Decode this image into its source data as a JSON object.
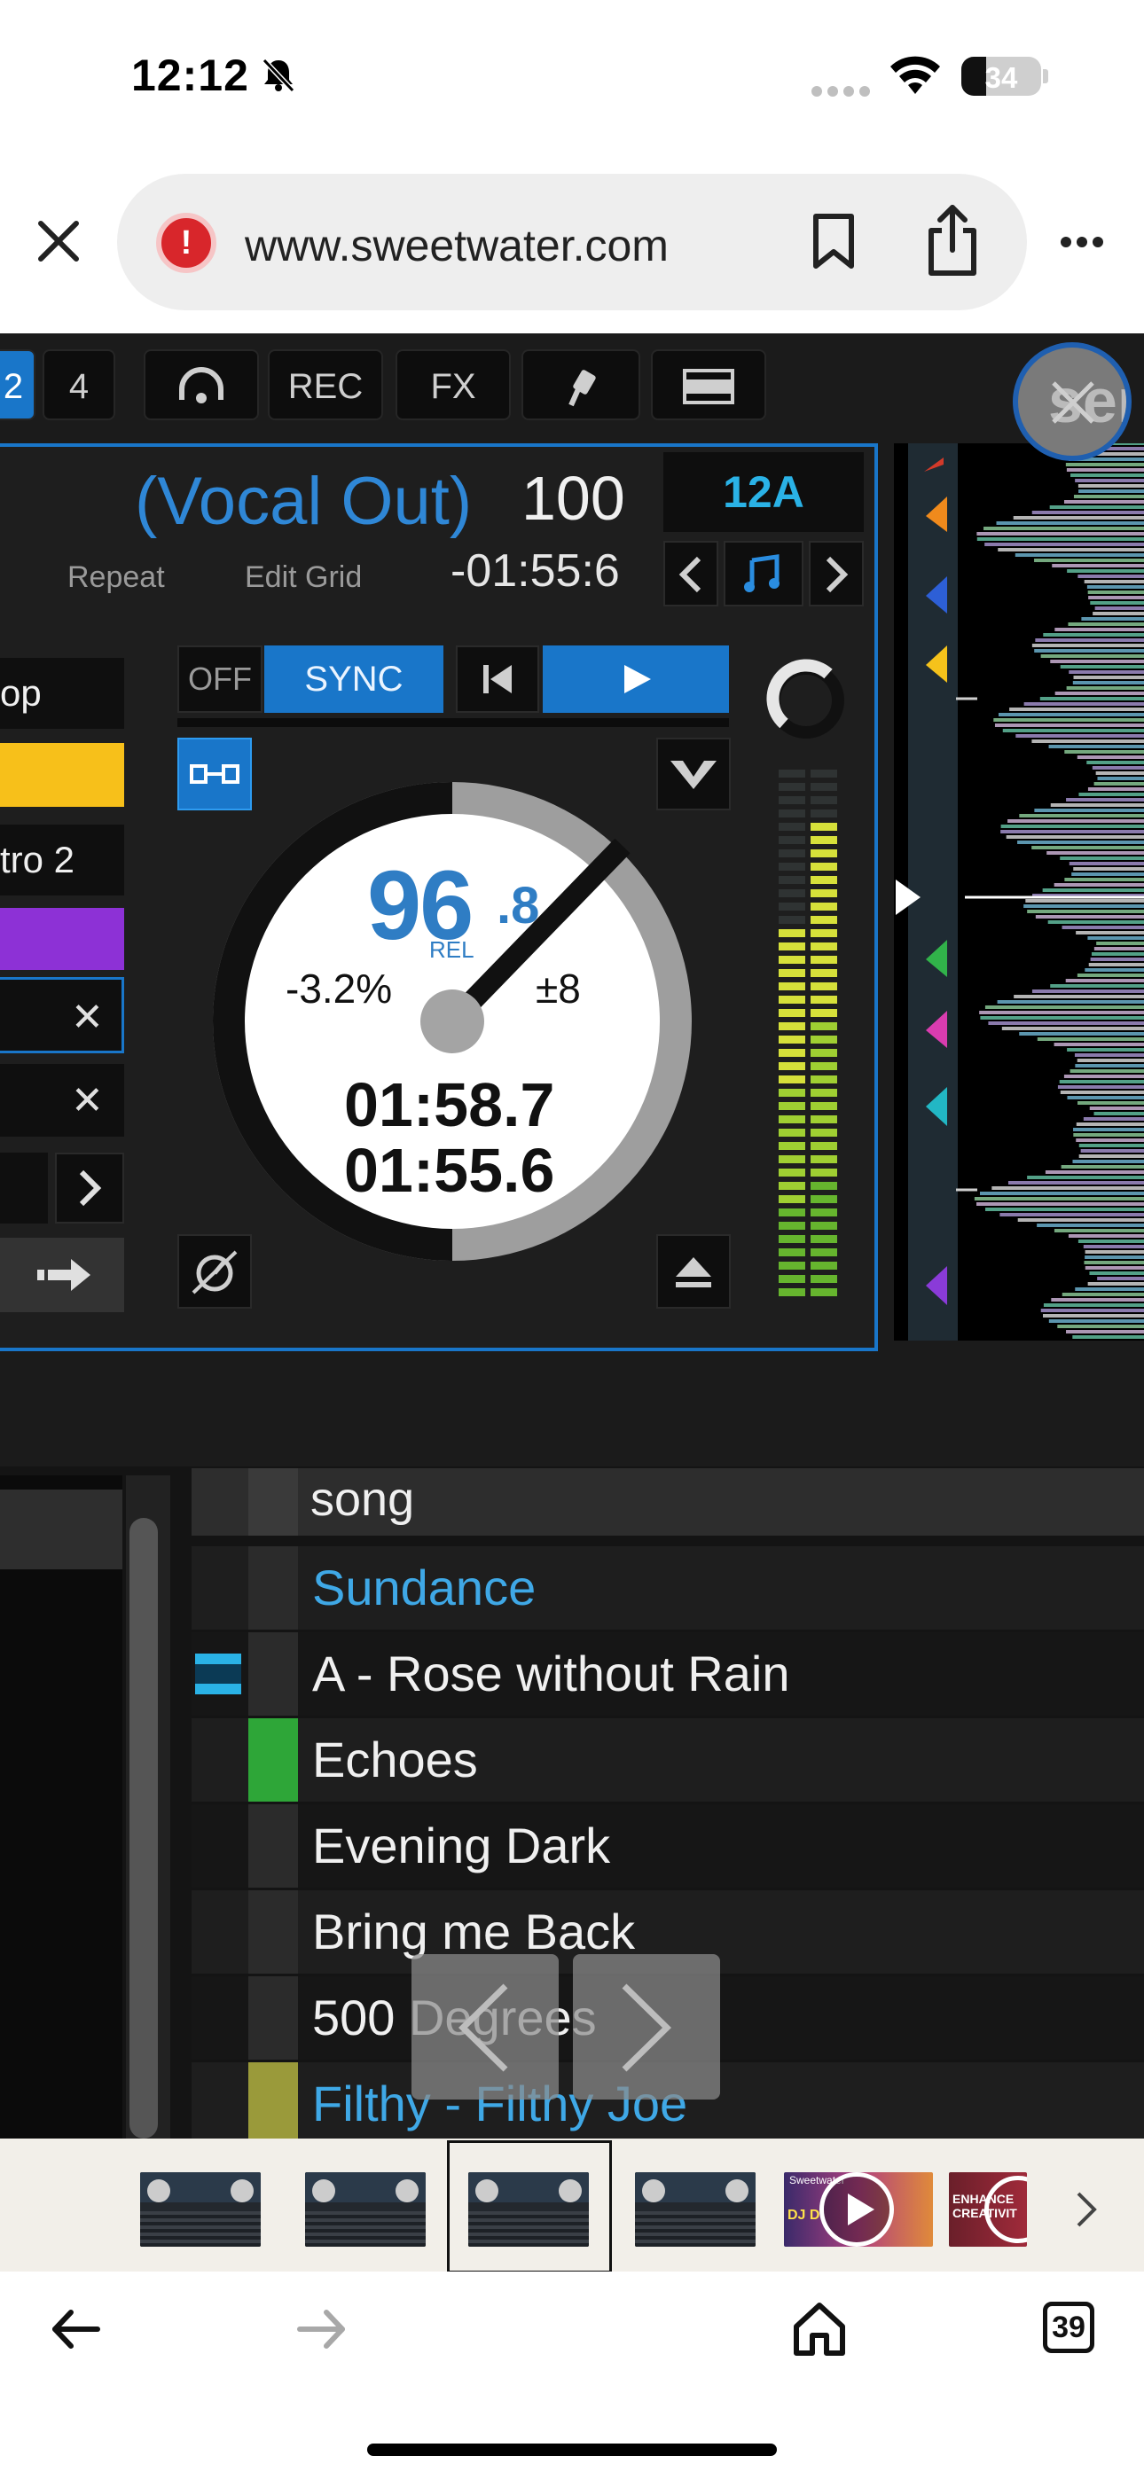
{
  "status_bar": {
    "time": "12:12",
    "battery": "34"
  },
  "browser": {
    "url": "www.sweetwater.com",
    "tabs_count": "39"
  },
  "deck": {
    "top_buttons": [
      "2",
      "4",
      "REC",
      "FX"
    ],
    "track_title": "(Vocal Out)",
    "bpm": "100",
    "key": "12A",
    "repeat_label": "Repeat",
    "edit_grid_label": "Edit Grid",
    "remaining_time": "-01:55:6",
    "off_label": "OFF",
    "sync_label": "SYNC",
    "pitch_value": "96",
    "pitch_decimal": ".8",
    "pitch_mode": "REL",
    "pitch_percent": "-3.2%",
    "pitch_range": "±8",
    "elapsed_time": "01:58.7",
    "remain_time_2": "01:55.6",
    "left_items": [
      "op",
      "tro 2"
    ],
    "overlay_logo_text": "ser"
  },
  "track_list": {
    "header": "song",
    "rows": [
      {
        "name": "Sundance",
        "color": "#3fa8e6",
        "swatch": ""
      },
      {
        "name": "A - Rose without Rain",
        "color": "#f0f0f0",
        "swatch": "",
        "video": true
      },
      {
        "name": "Echoes",
        "color": "#f0f0f0",
        "swatch": "#2ea638"
      },
      {
        "name": "Evening Dark",
        "color": "#f0f0f0",
        "swatch": ""
      },
      {
        "name": "Bring me Back",
        "color": "#f0f0f0",
        "swatch": ""
      },
      {
        "name": "500 Degrees",
        "color": "#f0f0f0",
        "swatch": ""
      },
      {
        "name": "Filthy - Filthy Joe",
        "color": "#3fa8e6",
        "swatch": "#9a9a3a"
      }
    ]
  },
  "thumbnails": {
    "count": 6,
    "selected_index": 2,
    "labels": [
      "",
      "",
      "",
      "",
      "DJ D",
      "ENHANCE CREATIVIT"
    ],
    "brand_small": "Sweetwater"
  }
}
